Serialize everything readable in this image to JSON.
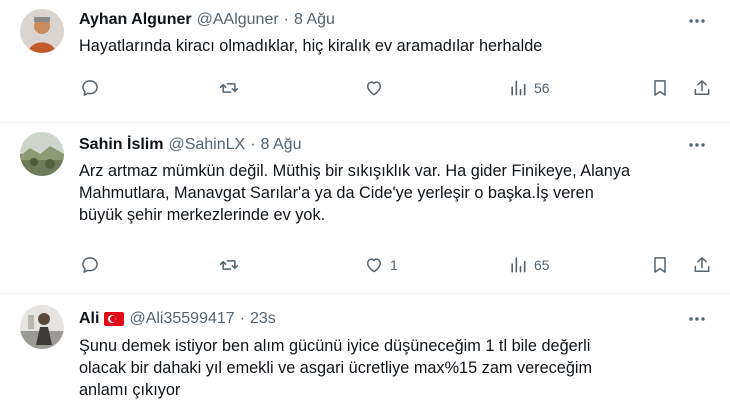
{
  "tweets": [
    {
      "name": "Ayhan Alguner",
      "handle": "@AAlguner",
      "dot": "·",
      "time": "8 Ağu",
      "text": "Hayatlarında kiracı olmadıklar, hiç kiralık ev aramadılar herhalde",
      "replies": "",
      "retweets": "",
      "likes": "",
      "views": "56"
    },
    {
      "name": "Sahin İslim",
      "handle": "@SahinLX",
      "dot": "·",
      "time": "8 Ağu",
      "text": "Arz artmaz mümkün değil. Müthiş bir sıkışıklık var. Ha gider Finikeye, Alanya\nMahmutlara, Manavgat Sarılar'a ya da  Cide'ye  yerleşir o başka.İş veren\nbüyük şehir merkezlerinde ev yok.",
      "replies": "",
      "retweets": "",
      "likes": "1",
      "views": "65"
    },
    {
      "name": "Ali",
      "handle": "@Ali35599417",
      "dot": "·",
      "time": "23s",
      "text": "Şunu demek istiyor ben alım gücünü iyice düşüneceğim 1 tl bile değerli\nolacak bir dahaki yıl emekli ve asgari ücretliye max%15 zam vereceğim\nanlamı çıkıyor",
      "flag": "Turkey flag"
    }
  ],
  "colors": {
    "text": "#0f1419",
    "secondary": "#536471",
    "divider": "#eff3f4",
    "flag": "#e30a17"
  },
  "icons": [
    "reply-icon",
    "retweet-icon",
    "like-icon",
    "views-icon",
    "bookmark-icon",
    "share-icon",
    "more-icon"
  ]
}
